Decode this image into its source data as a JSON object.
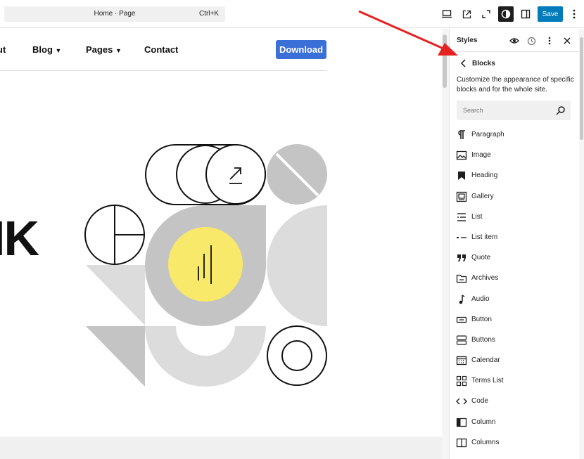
{
  "topbar": {
    "command_label": "Home · Page",
    "shortcut": "Ctrl+K",
    "save_label": "Save"
  },
  "site": {
    "nav": {
      "about_partial": "ut",
      "blog": "Blog",
      "pages": "Pages",
      "contact": "Contact",
      "download": "Download"
    },
    "hero_partial_text": "IK"
  },
  "panel": {
    "title": "Styles",
    "section_title": "Blocks",
    "description": "Customize the appearance of specific blocks and for the whole site.",
    "search_placeholder": "Search",
    "blocks": [
      {
        "label": "Paragraph",
        "icon": "paragraph-icon"
      },
      {
        "label": "Image",
        "icon": "image-icon"
      },
      {
        "label": "Heading",
        "icon": "heading-icon"
      },
      {
        "label": "Gallery",
        "icon": "gallery-icon"
      },
      {
        "label": "List",
        "icon": "list-icon"
      },
      {
        "label": "List item",
        "icon": "list-item-icon"
      },
      {
        "label": "Quote",
        "icon": "quote-icon"
      },
      {
        "label": "Archives",
        "icon": "archives-icon"
      },
      {
        "label": "Audio",
        "icon": "audio-icon"
      },
      {
        "label": "Button",
        "icon": "button-icon"
      },
      {
        "label": "Buttons",
        "icon": "buttons-icon"
      },
      {
        "label": "Calendar",
        "icon": "calendar-icon"
      },
      {
        "label": "Terms List",
        "icon": "terms-list-icon"
      },
      {
        "label": "Code",
        "icon": "code-icon"
      },
      {
        "label": "Column",
        "icon": "column-icon"
      },
      {
        "label": "Columns",
        "icon": "columns-icon"
      }
    ]
  },
  "colors": {
    "accent": "#007cba",
    "download": "#3b6fd8",
    "annotation_arrow": "#e52222",
    "yellow": "#f8e96a"
  }
}
